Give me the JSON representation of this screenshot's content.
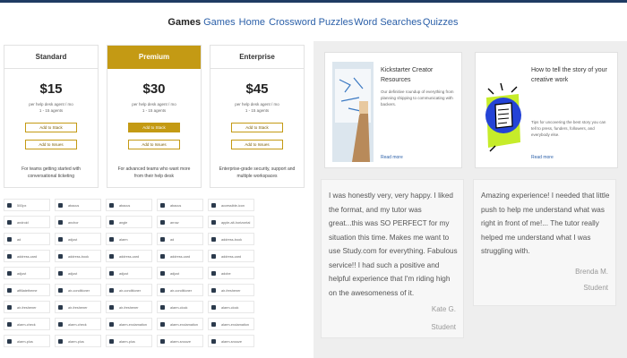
{
  "nav": {
    "brand": "Games",
    "links": [
      "Games",
      "Home",
      "Crossword Puzzles",
      "Word Searches",
      "Quizzes"
    ]
  },
  "plans": [
    {
      "name": "Standard",
      "price": "$15",
      "sub1": "per help desk agent / mo",
      "sub2": "1 - 15 agents",
      "btn1": "Add to Stack",
      "btn2": "Add to Issues",
      "desc": "For teams getting started with conversational ticketing"
    },
    {
      "name": "Premium",
      "price": "$30",
      "sub1": "per help desk agent / mo",
      "sub2": "1 - 15 agents",
      "btn1": "Add to Stack",
      "btn2": "Add to Issues",
      "desc": "For advanced teams who want more from their help desk"
    },
    {
      "name": "Enterprise",
      "price": "$45",
      "sub1": "per help desk agent / mo",
      "sub2": "1 - 15 agents",
      "btn1": "Add to Stack",
      "btn2": "Add to Issues",
      "desc": "Enterprise-grade security, support and multiple workspaces"
    }
  ],
  "grid_rows": [
    [
      "500px",
      "abacus",
      "abacus",
      "abacus",
      "accessible-icon"
    ],
    [
      "android",
      "anchor",
      "angle",
      "arrow",
      "apple-alt-horizontal"
    ],
    [
      "ad",
      "adjust",
      "alarm",
      "ad",
      "address-book"
    ],
    [
      "address-card",
      "address-book",
      "address-card",
      "address-card",
      "address-card"
    ],
    [
      "adjust",
      "adjust",
      "adjust",
      "adjust",
      "adobe"
    ],
    [
      "affiliatetheme",
      "air-conditioner",
      "air-conditioner",
      "air-conditioner",
      "air-freshener"
    ],
    [
      "air-freshener",
      "air-freshener",
      "air-freshener",
      "alarm-clock",
      "alarm-clock"
    ],
    [
      "alarm-check",
      "alarm-check",
      "alarm-exclamation",
      "alarm-exclamation",
      "alarm-exclamation"
    ],
    [
      "alarm-plus",
      "alarm-plus",
      "alarm-plus",
      "alarm-snooze",
      "alarm-snooze"
    ]
  ],
  "cards": [
    {
      "title": "Kickstarter Creator Resources",
      "desc": "Our definitive roundup of everything from planning shipping to communicating with backers.",
      "read_more": "Read more"
    },
    {
      "title": "How to tell the story of your creative work",
      "desc": "Tips for uncovering the best story you can tell to press, funders, followers, and everybody else.",
      "read_more": "Read more"
    }
  ],
  "reviews": [
    {
      "text": "I was honestly very, very happy. I liked the format, and my tutor was great...this was SO PERFECT for my situation this time. Makes me want to use Study.com for everything. Fabulous service!! I had such a positive and helpful experience that I'm riding high on the awesomeness of it.",
      "name": "Kate G.",
      "role": "Student"
    },
    {
      "text": "Amazing experience! I needed that little push to help me understand what was right in front of me!... The tutor really helped me understand what I was struggling with.",
      "name": "Brenda M.",
      "role": "Student"
    }
  ],
  "colors": {
    "accent": "#c49a14",
    "nav_link": "#2a5fa8",
    "right_bg": "#eeeeee"
  }
}
